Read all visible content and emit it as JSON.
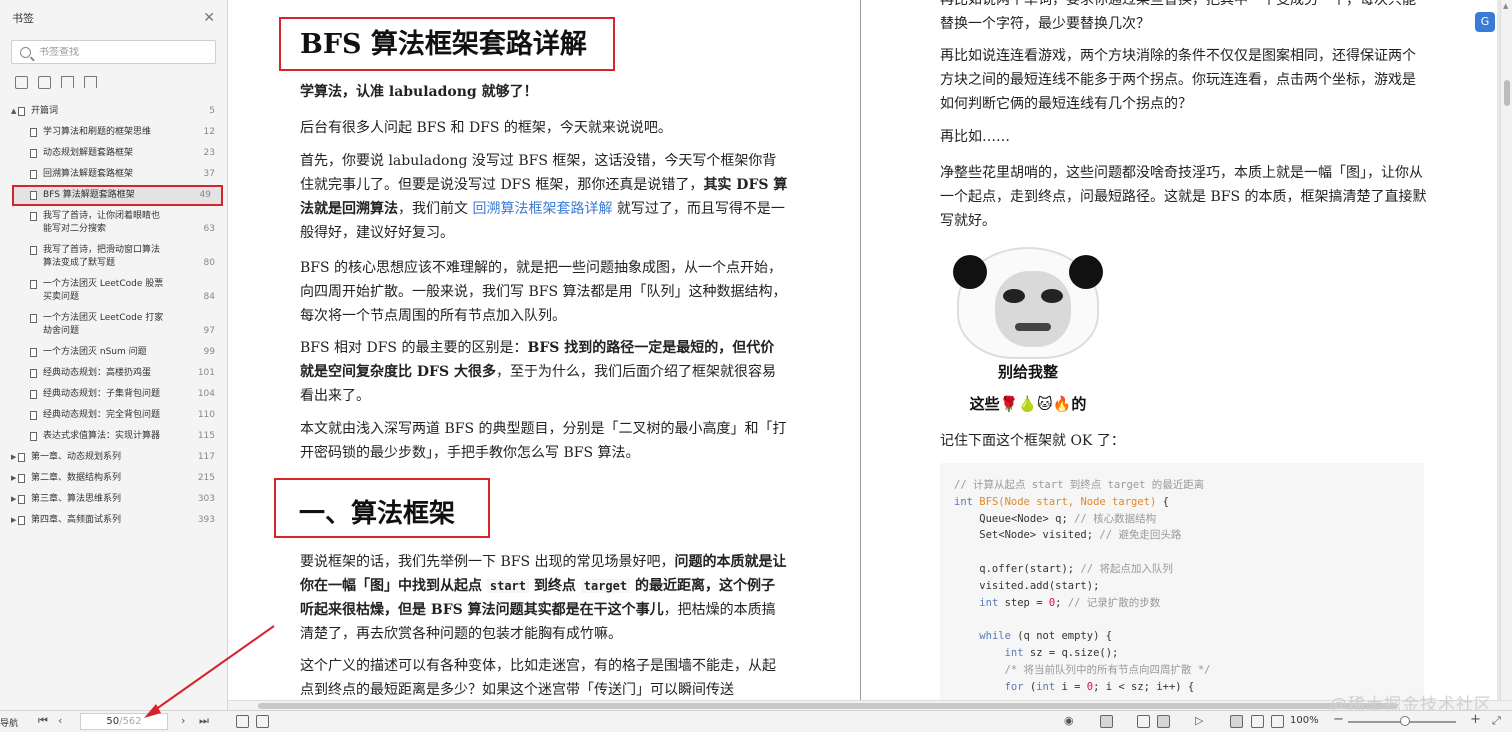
{
  "sidebar": {
    "title": "书签",
    "search_placeholder": "书签查找",
    "items": [
      {
        "title": "开篇词",
        "page": "5",
        "level": 0,
        "arrow": "▲"
      },
      {
        "title": "学习算法和刷题的框架思维",
        "page": "12",
        "level": 1
      },
      {
        "title": "动态规划解题套路框架",
        "page": "23",
        "level": 1
      },
      {
        "title": "回溯算法解题套路框架",
        "page": "37",
        "level": 1
      },
      {
        "title": "BFS 算法解题套路框架",
        "page": "49",
        "level": 1,
        "active": true
      },
      {
        "title": "我写了首诗，让你闭着眼睛也能写对二分搜索",
        "page": "63",
        "level": 1
      },
      {
        "title": "我写了首诗，把滑动窗口算法算法变成了默写题",
        "page": "80",
        "level": 1
      },
      {
        "title": "一个方法团灭 LeetCode 股票买卖问题",
        "page": "84",
        "level": 1
      },
      {
        "title": "一个方法团灭 LeetCode 打家劫舍问题",
        "page": "97",
        "level": 1
      },
      {
        "title": "一个方法团灭 nSum 问题",
        "page": "99",
        "level": 1
      },
      {
        "title": "经典动态规划：高楼扔鸡蛋",
        "page": "101",
        "level": 1
      },
      {
        "title": "经典动态规划：子集背包问题",
        "page": "104",
        "level": 1
      },
      {
        "title": "经典动态规划：完全背包问题",
        "page": "110",
        "level": 1
      },
      {
        "title": "表达式求值算法：实现计算器",
        "page": "115",
        "level": 1
      },
      {
        "title": "第一章、动态规划系列",
        "page": "117",
        "level": 0,
        "arrow": "▶"
      },
      {
        "title": "第二章、数据结构系列",
        "page": "215",
        "level": 0,
        "arrow": "▶"
      },
      {
        "title": "第三章、算法思维系列",
        "page": "303",
        "level": 0,
        "arrow": "▶"
      },
      {
        "title": "第四章、高频面试系列",
        "page": "393",
        "level": 0,
        "arrow": "▶"
      }
    ]
  },
  "left_page": {
    "heading": "BFS 算法框架套路详解",
    "p0": "学算法，认准 labuladong 就够了！",
    "p1": "后台有很多人问起 BFS 和 DFS 的框架，今天就来说说吧。",
    "p2a": "首先，你要说 labuladong 没写过 BFS 框架，这话没错，今天写个框架你背住就完事儿了。但要是说没写过 DFS 框架，那你还真是说错了，",
    "p2b": "其实 DFS 算法就是回溯算法",
    "p2c": "，我们前文 ",
    "p2link": "回溯算法框架套路详解",
    "p2d": " 就写过了，而且写得不是一般得好，建议好好复习。",
    "p3": "BFS 的核心思想应该不难理解的，就是把一些问题抽象成图，从一个点开始，向四周开始扩散。一般来说，我们写 BFS 算法都是用「队列」这种数据结构，每次将一个节点周围的所有节点加入队列。",
    "p4a": "BFS 相对 DFS 的最主要的区别是：",
    "p4b": "BFS 找到的路径一定是最短的，但代价就是空间复杂度比 DFS 大很多",
    "p4c": "，至于为什么，我们后面介绍了框架就很容易看出来了。",
    "p5": "本文就由浅入深写两道 BFS 的典型题目，分别是「二叉树的最小高度」和「打开密码锁的最少步数」，手把手教你怎么写 BFS 算法。",
    "heading2": "一、算法框架",
    "p6a": "要说框架的话，我们先举例一下 BFS 出现的常见场景好吧，",
    "p6b": "问题的本质就是让你在一幅「图」中找到从起点 ",
    "p6code1": "start",
    "p6c": " 到终点 ",
    "p6code2": "target",
    "p6d": " 的最近距离，这个例子听起来很枯燥，但是 BFS 算法问题其实都是在干这个事儿",
    "p6e": "，把枯燥的本质搞清楚了，再去欣赏各种问题的包装才能胸有成竹嘛。",
    "p7": "这个广义的描述可以有各种变体，比如走迷宫，有的格子是围墙不能走，从起点到终点的最短距离是多少？如果这个迷宫带「传送门」可以瞬间传送"
  },
  "right_page": {
    "p_top": "再比如说两个单词，要求你通过某些替换，把其中一个变成另一个，每次只能替换一个字符，最少要替换几次？",
    "p1": "再比如说连连看游戏，两个方块消除的条件不仅仅是图案相同，还得保证两个方块之间的最短连线不能多于两个拐点。你玩连连看，点击两个坐标，游戏是如何判断它俩的最短连线有几个拐点的？",
    "p2": "再比如……",
    "p3": "净整些花里胡哨的，这些问题都没啥奇技淫巧，本质上就是一幅「图」，让你从一个起点，走到终点，问最短路径。这就是 BFS 的本质，框架搞清楚了直接默写就好。",
    "meme_caption1": "别给我整",
    "meme_caption2": "这些🌹🍐🐱🔥的",
    "p4": "记住下面这个框架就 OK 了：",
    "code": [
      {
        "t": "cm",
        "s": "// 计算从起点 start 到终点 target 的最近距离"
      },
      {
        "t": "sig",
        "s": ""
      },
      {
        "t": "plain",
        "s": "    Queue<Node> q; ",
        "c": "// 核心数据结构"
      },
      {
        "t": "plain",
        "s": "    Set<Node> visited; ",
        "c": "// 避免走回头路"
      },
      {
        "t": "blank",
        "s": ""
      },
      {
        "t": "plain",
        "s": "    q.offer(start); ",
        "c": "// 将起点加入队列"
      },
      {
        "t": "plain",
        "s": "    visited.add(start);",
        "c": ""
      },
      {
        "t": "step",
        "s": ""
      },
      {
        "t": "blank",
        "s": ""
      },
      {
        "t": "while",
        "s": ""
      },
      {
        "t": "sz",
        "s": ""
      },
      {
        "t": "cm2",
        "s": "        /* 将当前队列中的所有节点向四周扩散 */"
      },
      {
        "t": "for",
        "s": ""
      }
    ]
  },
  "statusbar": {
    "label": "导航",
    "page_current": "50",
    "page_total": "/562",
    "zoom": "100%"
  },
  "watermark": "@稀土掘金技术社区"
}
